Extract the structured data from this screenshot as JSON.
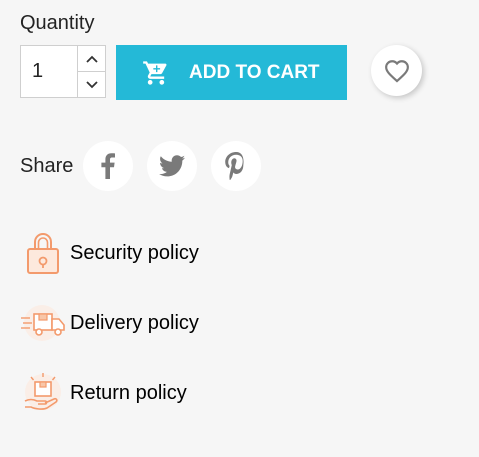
{
  "quantity": {
    "label": "Quantity",
    "value": "1"
  },
  "cart_button": {
    "label": "ADD TO CART",
    "color": "#24b9d7"
  },
  "share": {
    "label": "Share",
    "networks": [
      "facebook-icon",
      "twitter-icon",
      "pinterest-icon"
    ]
  },
  "policies": [
    {
      "label": "Security policy",
      "icon": "padlock-icon"
    },
    {
      "label": "Delivery policy",
      "icon": "delivery-truck-icon"
    },
    {
      "label": "Return policy",
      "icon": "return-hand-box-icon"
    }
  ],
  "colors": {
    "accent": "#24b9d7",
    "policy_icon": "#f39a6c",
    "background": "#f6f6f6"
  }
}
